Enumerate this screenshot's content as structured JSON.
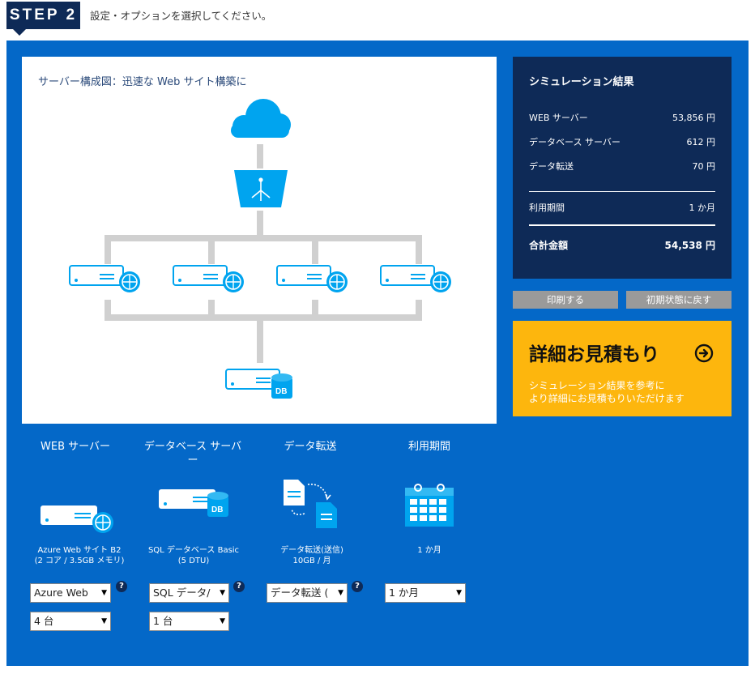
{
  "header": {
    "step_label": "STEP 2",
    "instruction": "設定・オプションを選択してください。"
  },
  "diagram": {
    "title": "サーバー構成図：迅速な Web サイト構築に",
    "db_label": "DB"
  },
  "result": {
    "title": "シミュレーション結果",
    "rows": [
      {
        "label": "WEB サーバー",
        "value": "53,856 円"
      },
      {
        "label": "データベース サーバー",
        "value": "612 円"
      },
      {
        "label": "データ転送",
        "value": "70 円"
      }
    ],
    "period": {
      "label": "利用期間",
      "value": "1 か月"
    },
    "total": {
      "label": "合計金額",
      "value": "54,538 円"
    }
  },
  "buttons": {
    "print": "印刷する",
    "reset": "初期状態に戻す"
  },
  "cta": {
    "title": "詳細お見積もり",
    "line1": "シミュレーション結果を参考に",
    "line2": "より詳細にお見積もりいただけます"
  },
  "options": {
    "web": {
      "heading": "WEB サーバー",
      "caption1": "Azure Web サイト B2",
      "caption2": "(2 コア / 3.5GB メモリ)",
      "select1": "Azure Web",
      "select2": "4 台"
    },
    "db": {
      "heading1": "データベース サーバ",
      "heading2": "ー",
      "caption1": "SQL データベース Basic",
      "caption2": "(5 DTU)",
      "select1": "SQL データ/",
      "select2": "1 台",
      "icon_label": "DB"
    },
    "transfer": {
      "heading": "データ転送",
      "caption1": "データ転送(送信)",
      "caption2": "10GB / 月",
      "select1": "データ転送 ("
    },
    "period": {
      "heading": "利用期間",
      "caption1": "1 か月",
      "select1": "1 か月"
    }
  },
  "help_glyph": "?",
  "select_arrow": "▼",
  "colors": {
    "panel_blue": "#0468c8",
    "navy": "#0e2a57",
    "cyan": "#00a4ef",
    "cta_yellow": "#fdb60d",
    "button_gray": "#9a9a9a"
  }
}
